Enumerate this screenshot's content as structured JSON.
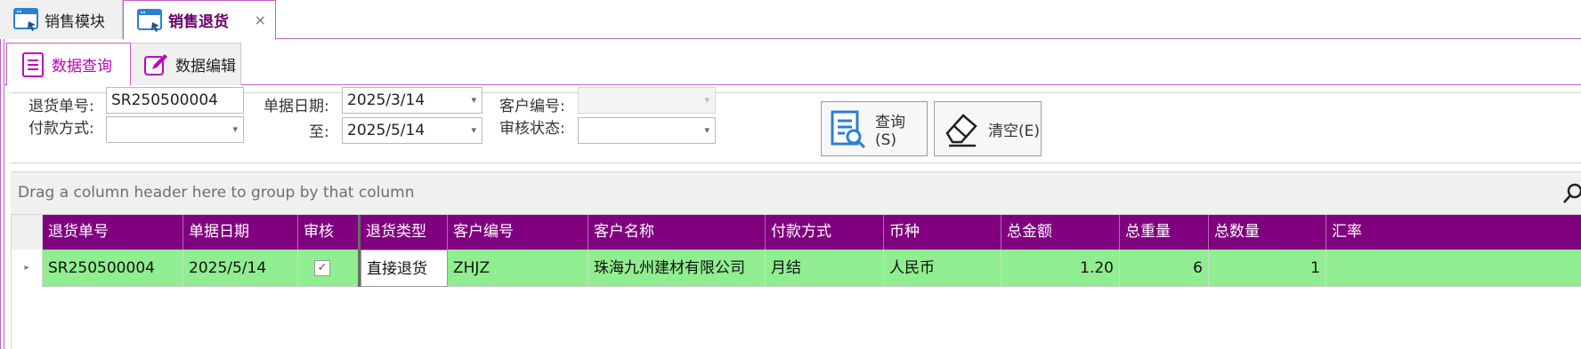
{
  "doc_tabs": [
    {
      "label": "销售模块"
    },
    {
      "label": "销售退货",
      "close": "×"
    }
  ],
  "page_tabs": [
    {
      "label": "数据查询"
    },
    {
      "label": "数据编辑"
    }
  ],
  "filters": {
    "return_no_label": "退货单号:",
    "return_no_value": "SR250500004",
    "doc_date_label": "单据日期:",
    "doc_date_from": "2025/3/14",
    "to_label": "至:",
    "doc_date_to": "2025/5/14",
    "customer_no_label": "客户编号:",
    "customer_no_value": "",
    "payment_label": "付款方式:",
    "payment_value": "",
    "audit_status_label": "审核状态:",
    "audit_status_value": "",
    "dropdown_glyph": "▾"
  },
  "buttons": {
    "query": "查询(S)",
    "clear": "清空(E)"
  },
  "group_panel": {
    "hint": "Drag a column header here to group by that column"
  },
  "grid": {
    "headers": [
      "退货单号",
      "单据日期",
      "审核",
      "退货类型",
      "客户编号",
      "客户名称",
      "付款方式",
      "币种",
      "总金额",
      "总重量",
      "总数量",
      "汇率"
    ],
    "rows": [
      {
        "indicator": "▸",
        "return_no": "SR250500004",
        "doc_date": "2025/5/14",
        "audited": "✓",
        "return_type": "直接退货",
        "customer_no": "ZHJZ",
        "customer_name": "珠海九州建材有限公司",
        "payment": "月结",
        "currency": "人民币",
        "total_amount": "1.20",
        "total_weight": "6",
        "total_qty": "1",
        "rate": ""
      }
    ]
  },
  "colors": {
    "accent": "#800080",
    "row_highlight": "#90ee90",
    "tab_active_text": "#c000c0"
  }
}
